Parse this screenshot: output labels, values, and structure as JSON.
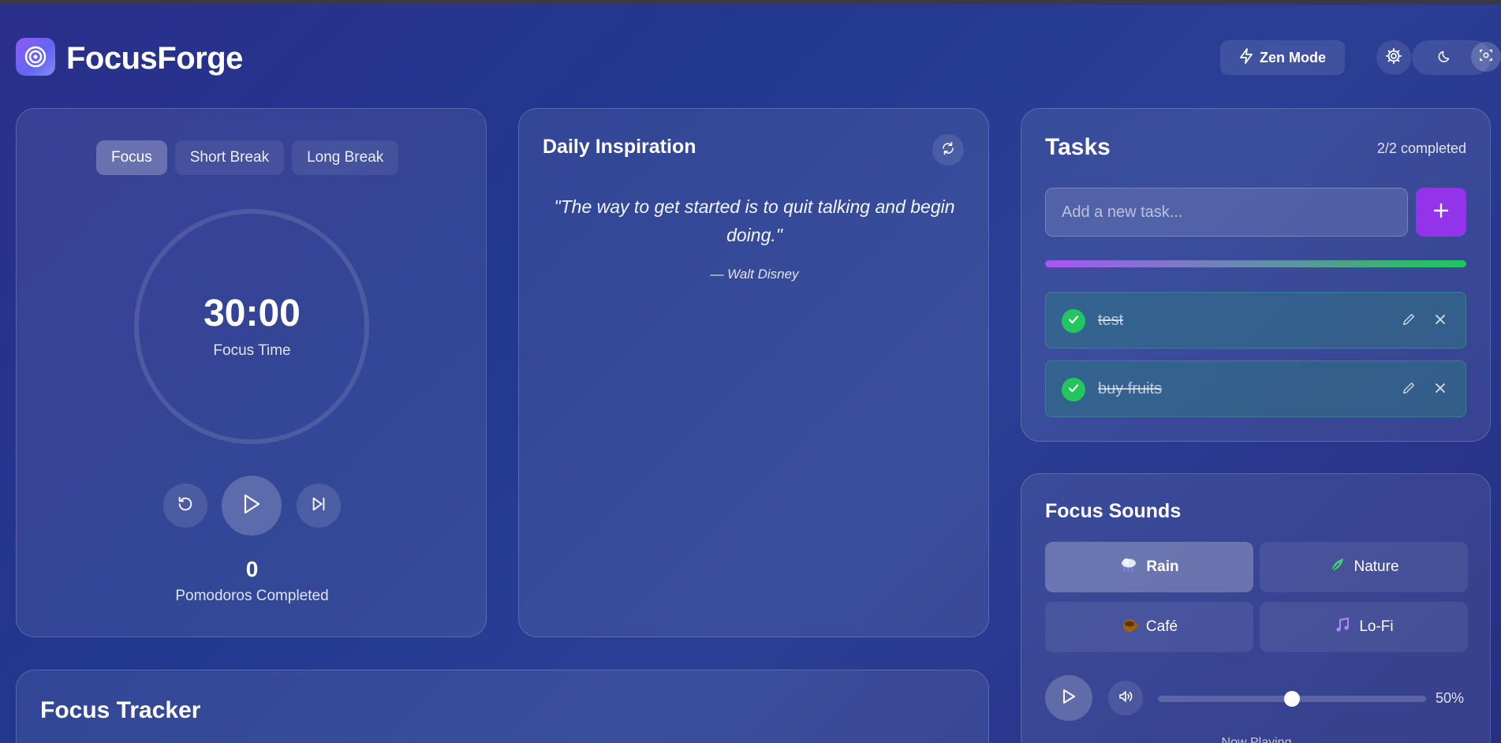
{
  "app": {
    "name": "FocusForge"
  },
  "header": {
    "zen_label": "Zen Mode",
    "icons": {
      "logo": "target-icon",
      "zen": "lightning-icon",
      "settings": "gear-icon",
      "theme": "moon-icon",
      "focus": "focus-scan-icon"
    }
  },
  "timer": {
    "tabs": [
      {
        "label": "Focus",
        "active": true
      },
      {
        "label": "Short Break",
        "active": false
      },
      {
        "label": "Long Break",
        "active": false
      }
    ],
    "time": "30:00",
    "time_label": "Focus Time",
    "pomodoros_count": "0",
    "pomodoros_label": "Pomodoros Completed"
  },
  "inspiration": {
    "title": "Daily Inspiration",
    "quote": "\"The way to get started is to quit talking and begin doing.\"",
    "author": "— Walt Disney"
  },
  "tasks": {
    "title": "Tasks",
    "count": "2/2 completed",
    "input_placeholder": "Add a new task...",
    "progress": 1.0,
    "items": [
      {
        "text": "test",
        "completed": true
      },
      {
        "text": "buy fruits",
        "completed": true
      }
    ]
  },
  "sounds": {
    "title": "Focus Sounds",
    "items": [
      {
        "label": "Rain",
        "icon": "rain-cloud-icon",
        "active": true
      },
      {
        "label": "Nature",
        "icon": "leaf-icon",
        "active": false
      },
      {
        "label": "Café",
        "icon": "coffee-icon",
        "active": false
      },
      {
        "label": "Lo-Fi",
        "icon": "music-note-icon",
        "active": false
      }
    ],
    "volume": 0.5,
    "volume_label": "50%",
    "now_playing": "Now Playing"
  },
  "tracker": {
    "title": "Focus Tracker"
  },
  "colors": {
    "accent": "#9333ea",
    "success": "#22c55e",
    "background": "#25368c"
  }
}
